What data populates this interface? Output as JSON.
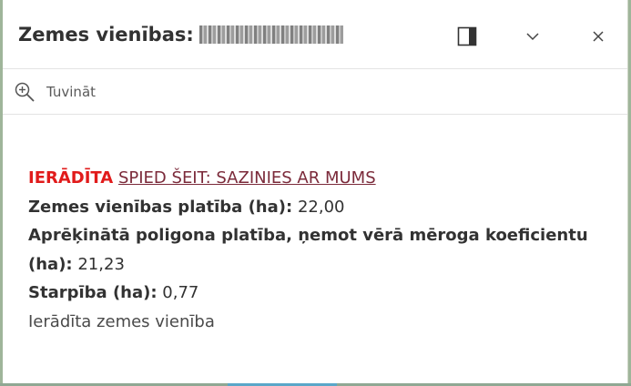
{
  "popup": {
    "title": "Zemes vienības:",
    "title_id_redacted": "",
    "controls": {
      "dock_icon": "dock-icon",
      "collapse_icon": "chevron-down-icon",
      "close_icon": "close-icon"
    }
  },
  "toolbar": {
    "zoom_label": "Tuvināt",
    "zoom_icon": "zoom-in-icon"
  },
  "content": {
    "status": "IERĀDĪTA",
    "contact_link": "SPIED ŠEIT: SAZINIES AR MUMS",
    "area_label": "Zemes vienības platība (ha):",
    "area_value": "22,00",
    "calc_label_line1": "Aprēķinātā poligona platība, ņemot vērā mēroga koeficientu",
    "calc_label_line2": "(ha):",
    "calc_value": "21,23",
    "diff_label": "Starpība (ha):",
    "diff_value": "0,77",
    "note": "Ierādīta zemes vienība"
  },
  "colors": {
    "status_red": "#e11b1b",
    "link": "#7b2a3a",
    "text": "#323232"
  }
}
